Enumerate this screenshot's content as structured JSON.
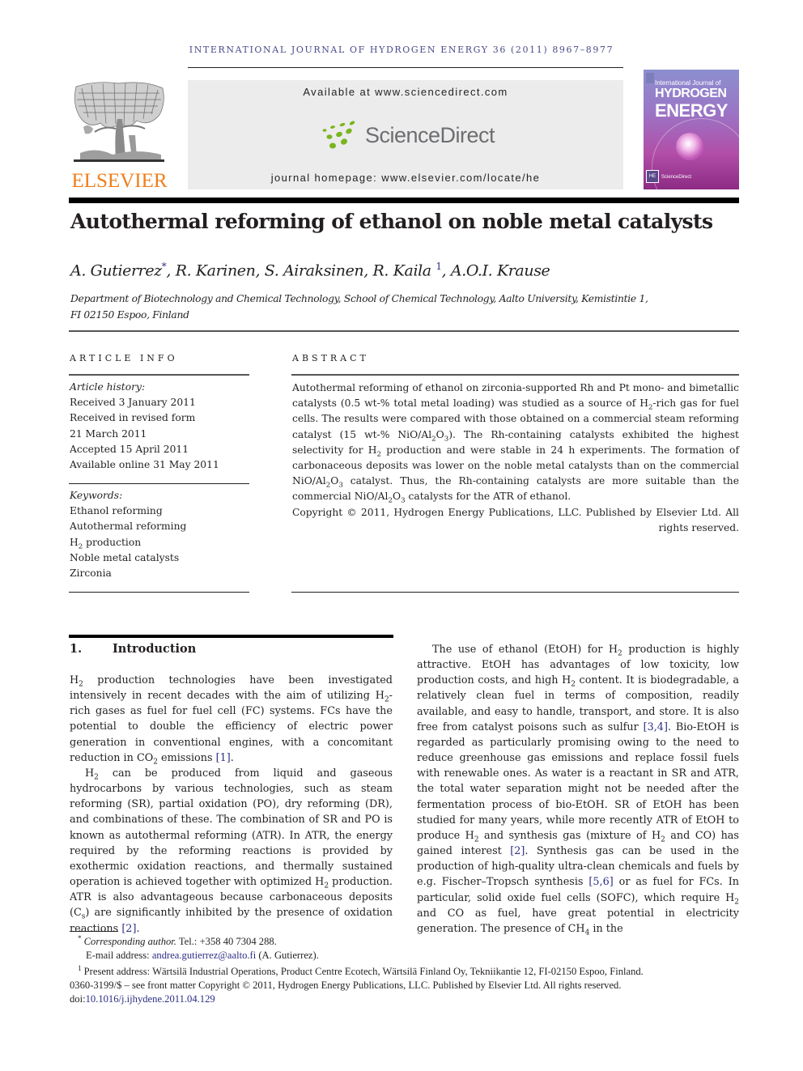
{
  "header": {
    "journal_line": "INTERNATIONAL JOURNAL OF HYDROGEN ENERGY 36 (2011) 8967–8977",
    "publisher_logo_text": "ELSEVIER",
    "available_at": "Available at www.sciencedirect.com",
    "sciencedirect_logo_text": "ScienceDirect",
    "journal_homepage": "journal homepage: www.elsevier.com/locate/he",
    "cover": {
      "line1": "International Journal of",
      "line2": "HYDROGEN",
      "line3": "ENERGY",
      "badge": "HE",
      "footer": "ScienceDirect"
    },
    "colors": {
      "elsevier_orange": "#f07e1b",
      "sciencedirect_green": "#7ab51d",
      "link_blue": "#2b2e83",
      "journal_line": "#4a4a8a"
    }
  },
  "article": {
    "title": "Autothermal reforming of ethanol on noble metal catalysts",
    "authors": [
      {
        "name": "A. Gutierrez",
        "mark": "*"
      },
      {
        "name": "R. Karinen",
        "mark": ""
      },
      {
        "name": "S. Airaksinen",
        "mark": ""
      },
      {
        "name": "R. Kaila",
        "mark": "1"
      },
      {
        "name": "A.O.I. Krause",
        "mark": ""
      }
    ],
    "affiliation_line1": "Department of Biotechnology and Chemical Technology, School of Chemical Technology, Aalto University, Kemistintie 1,",
    "affiliation_line2": "FI 02150 Espoo, Finland"
  },
  "article_info": {
    "heading": "ARTICLE INFO",
    "history_label": "Article history:",
    "history": [
      "Received 3 January 2011",
      "Received in revised form",
      "21 March 2011",
      "Accepted 15 April 2011",
      "Available online 31 May 2011"
    ],
    "keywords_label": "Keywords:",
    "keywords": [
      "Ethanol reforming",
      "Autothermal reforming",
      "H2 production",
      "Noble metal catalysts",
      "Zirconia"
    ]
  },
  "abstract": {
    "heading": "ABSTRACT",
    "t1": "Autothermal reforming of ethanol on zirconia-supported Rh and Pt mono- and bimetallic catalysts (0.5 wt-% total metal loading) was studied as a source of H",
    "t2": "-rich gas for fuel cells. The results were compared with those obtained on a commercial steam reforming catalyst (15 wt-% NiO/Al",
    "t3": "). The Rh-containing catalysts exhibited the highest selectivity for H",
    "t4": " production and were stable in 24 h experiments. The formation of carbonaceous deposits was lower on the noble metal catalysts than on the commercial NiO/Al",
    "t5": " catalyst. Thus, the Rh-containing catalysts are more suitable than the commercial NiO/Al",
    "t6": " catalysts for the ATR of ethanol.",
    "copyright": "Copyright © 2011, Hydrogen Energy Publications, LLC. Published by Elsevier Ltd. All rights reserved."
  },
  "section": {
    "number": "1.",
    "title": "Introduction"
  },
  "body_left": {
    "p1": {
      "a": " production technologies have been investigated intensively in recent decades with the aim of utilizing H",
      "b": "-rich gases as fuel for fuel cell (FC) systems. FCs have the potential to double the efficiency of electric power generation in conventional engines, with a concomitant reduction in CO",
      "c": " emissions ",
      "ref": "[1]",
      "d": "."
    },
    "p2": {
      "a": " can be produced from liquid and gaseous hydrocarbons by various technologies, such as steam reforming (SR), partial oxidation (PO), dry reforming (DR), and combinations of these. The combination of SR and PO is known as autothermal reforming (ATR). In ATR, the energy required by the reforming reactions is provided by exothermic oxidation reactions, and thermally sustained operation is achieved together with optimized H",
      "b": " production. ATR is also advantageous because carbonaceous deposits (C",
      "c": ") are significantly inhibited by the presence of oxidation reactions ",
      "ref": "[2]",
      "d": "."
    }
  },
  "body_right": {
    "a": "The use of ethanol (EtOH) for H",
    "b": " production is highly attractive. EtOH has advantages of low toxicity, low production costs, and high H",
    "c": " content. It is biodegradable, a relatively clean fuel in terms of composition, readily available, and easy to handle, transport, and store. It is also free from catalyst poisons such as sulfur ",
    "ref1": "[3,4]",
    "d": ". Bio-EtOH is regarded as particularly promising owing to the need to reduce greenhouse gas emissions and replace fossil fuels with renewable ones. As water is a reactant in SR and ATR, the total water separation might not be needed after the fermentation process of bio-EtOH. SR of EtOH has been studied for many years, while more recently ATR of EtOH to produce H",
    "e": " and synthesis gas (mixture of H",
    "f": " and CO) has gained interest ",
    "ref2": "[2]",
    "g": ". Synthesis gas can be used in the production of high-quality ultra-clean chemicals and fuels by e.g. Fischer–Tropsch synthesis ",
    "ref3": "[5,6]",
    "h": " or as fuel for FCs. In particular, solid oxide fuel cells (SOFC), which require H",
    "i": " and CO as fuel, have great potential in electricity generation. The presence of CH",
    "j": " in the"
  },
  "footnotes": {
    "corr_mark": "*",
    "corr_label": "Corresponding author.",
    "corr_tel": " Tel.: +358 40 7304 288.",
    "email_label": "E-mail address: ",
    "email": "andrea.gutierrez@aalto.fi",
    "email_suffix": " (A. Gutierrez).",
    "present_mark": "1",
    "present_address": "Present address: Wärtsilä Industrial Operations, Product Centre Ecotech, Wärtsilä Finland Oy, Tekniikantie 12, FI-02150 Espoo, Finland.",
    "issn_line": "0360-3199/$ – see front matter Copyright © 2011, Hydrogen Energy Publications, LLC. Published by Elsevier Ltd. All rights reserved.",
    "doi_label": "doi:",
    "doi": "10.1016/j.ijhydene.2011.04.129"
  }
}
